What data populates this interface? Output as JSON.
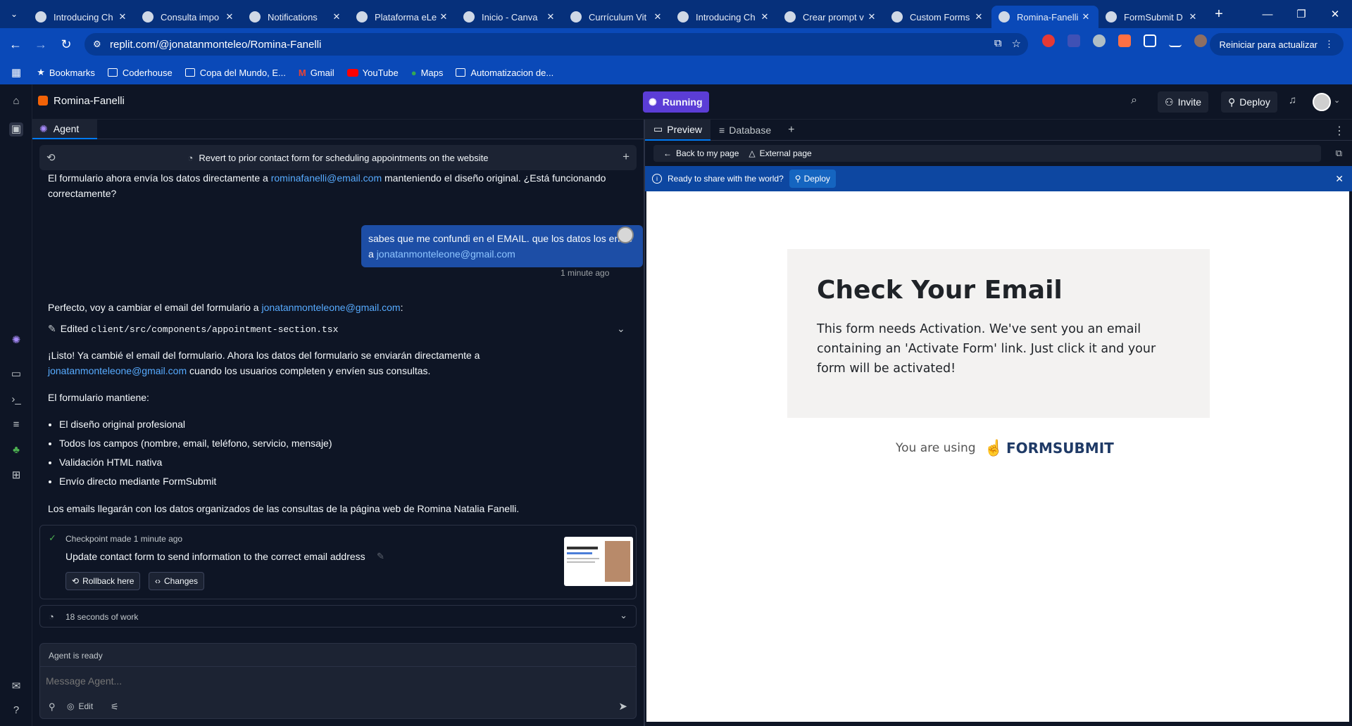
{
  "browser": {
    "tabs": [
      {
        "title": "Introducing Ch",
        "active": false
      },
      {
        "title": "Consulta impo",
        "active": false
      },
      {
        "title": "Notifications",
        "active": false
      },
      {
        "title": "Plataforma eLe",
        "active": false
      },
      {
        "title": "Inicio - Canva",
        "active": false
      },
      {
        "title": "Currículum Vit",
        "active": false
      },
      {
        "title": "Introducing Ch",
        "active": false
      },
      {
        "title": "Crear prompt v",
        "active": false
      },
      {
        "title": "Custom Forms",
        "active": false
      },
      {
        "title": "Romina-Fanelli",
        "active": true
      },
      {
        "title": "FormSubmit D",
        "active": false
      }
    ],
    "url": "replit.com/@jonatanmonteleo/Romina-Fanelli",
    "relaunch_label": "Reiniciar para actualizar",
    "bookmarks": [
      "Bookmarks",
      "Coderhouse",
      "Copa del Mundo, E...",
      "Gmail",
      "YouTube",
      "Maps",
      "Automatizacion de..."
    ],
    "accent_color": "#0a49b8"
  },
  "replit": {
    "project_name": "Romina-Fanelli",
    "status_label": "Running",
    "invite_label": "Invite",
    "deploy_label": "Deploy",
    "agent": {
      "tab_label": "Agent",
      "conversation_title": "Revert to prior contact form for scheduling appointments on the website",
      "msg_prev_1": "El formulario ahora envía los datos directamente a ",
      "msg_prev_email": "rominafanelli@email.com",
      "msg_prev_2": " manteniendo el diseño original. ¿Está funcionando",
      "msg_prev_3": "correctamente?",
      "user_msg_1": "sabes que me confundi en el EMAIL. que los datos los envie a ",
      "user_msg_email": "jonatanmonteleone@gmail.com",
      "user_msg_time": "1 minute ago",
      "reply_intro": "Perfecto, voy a cambiar el email del formulario a ",
      "reply_email": "jonatanmonteleone@gmail.com",
      "reply_intro_end": ":",
      "edited_label": "Edited ",
      "edited_file": "client/src/components/appointment-section.tsx",
      "listo_1": "¡Listo! Ya cambié el email del formulario. Ahora los datos del formulario se enviarán directamente a",
      "listo_email": "jonatanmonteleone@gmail.com",
      "listo_2": " cuando los usuarios completen y envíen sus consultas.",
      "mantiene": "El formulario mantiene:",
      "bullets": [
        "El diseño original profesional",
        "Todos los campos (nombre, email, teléfono, servicio, mensaje)",
        "Validación HTML nativa",
        "Envío directo mediante FormSubmit"
      ],
      "closing": "Los emails llegarán con los datos organizados de las consultas de la página web de Romina Natalia Fanelli.",
      "checkpoint_label": "Checkpoint made 1 minute ago",
      "checkpoint_title": "Update contact form to send information to the correct email address",
      "rollback_label": "Rollback here",
      "changes_label": "Changes",
      "work_label": "18 seconds of work",
      "ready_label": "Agent is ready",
      "input_placeholder": "Message Agent...",
      "edit_label": "Edit"
    },
    "preview": {
      "tab_preview": "Preview",
      "tab_database": "Database",
      "back_label": "Back to my page",
      "external_label": "External page",
      "banner_text": "Ready to share with the world?",
      "banner_deploy": "Deploy",
      "fs_title": "Check Your Email",
      "fs_body": "This form needs Activation. We've sent you an email containing an 'Activate Form' link. Just click it and your form will be activated!",
      "fs_using": "You are using",
      "fs_brand": "FORMSUBMIT"
    }
  }
}
